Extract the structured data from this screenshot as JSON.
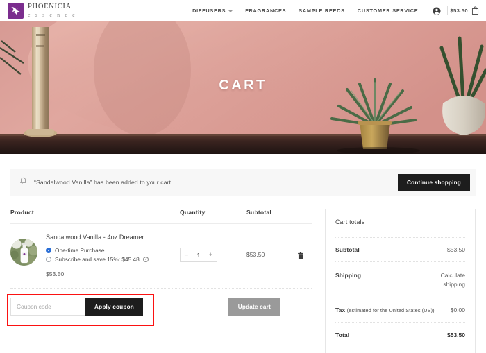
{
  "brand": {
    "name": "PHOENICIA",
    "tagline": "e s s e n c e",
    "logo_color": "#7b2d8e",
    "logo_icon": "phoenix-bird-icon"
  },
  "nav": {
    "items": [
      {
        "label": "DIFFUSERS",
        "has_dropdown": true
      },
      {
        "label": "FRAGRANCES",
        "has_dropdown": false
      },
      {
        "label": "SAMPLE REEDS",
        "has_dropdown": false
      },
      {
        "label": "CUSTOMER SERVICE",
        "has_dropdown": false
      }
    ],
    "account_icon": "user-account-icon",
    "cart_icon": "shopping-bag-icon",
    "cart_amount": "$53.50"
  },
  "hero": {
    "title": "CART",
    "background_color": "#d99a93",
    "shelf_color": "#3c2420"
  },
  "notice": {
    "icon": "bell-icon",
    "message": "“Sandalwood Vanilla” has been added to your cart.",
    "button_label": "Continue shopping"
  },
  "cart_table": {
    "headers": {
      "product": "Product",
      "quantity": "Quantity",
      "subtotal": "Subtotal"
    },
    "rows": [
      {
        "thumbnail_icon": "product-bottle-thumbnail",
        "name": "Sandalwood Vanilla - 4oz Dreamer",
        "options": [
          {
            "label": "One-time Purchase",
            "selected": true,
            "has_info": false
          },
          {
            "label": "Subscribe and save 15%: $45.48",
            "selected": false,
            "has_info": true
          }
        ],
        "price": "$53.50",
        "quantity": "1",
        "decrement_label": "–",
        "increment_label": "+",
        "subtotal": "$53.50",
        "remove_icon": "trash-icon"
      }
    ]
  },
  "coupon": {
    "placeholder": "Coupon code",
    "value": "",
    "apply_label": "Apply coupon",
    "update_label": "Update cart",
    "highlight_color": "#fb1212"
  },
  "cart_totals": {
    "title": "Cart totals",
    "rows": [
      {
        "label": "Subtotal",
        "note": "",
        "value": "$53.50",
        "emphasis": false
      },
      {
        "label": "Shipping",
        "note": "",
        "value": "Calculate\nshipping",
        "emphasis": false
      },
      {
        "label": "Tax ",
        "note": "(estimated for the United States (US))",
        "value": "$0.00",
        "emphasis": false
      },
      {
        "label": "Total",
        "note": "",
        "value": "$53.50",
        "emphasis": true
      }
    ]
  }
}
